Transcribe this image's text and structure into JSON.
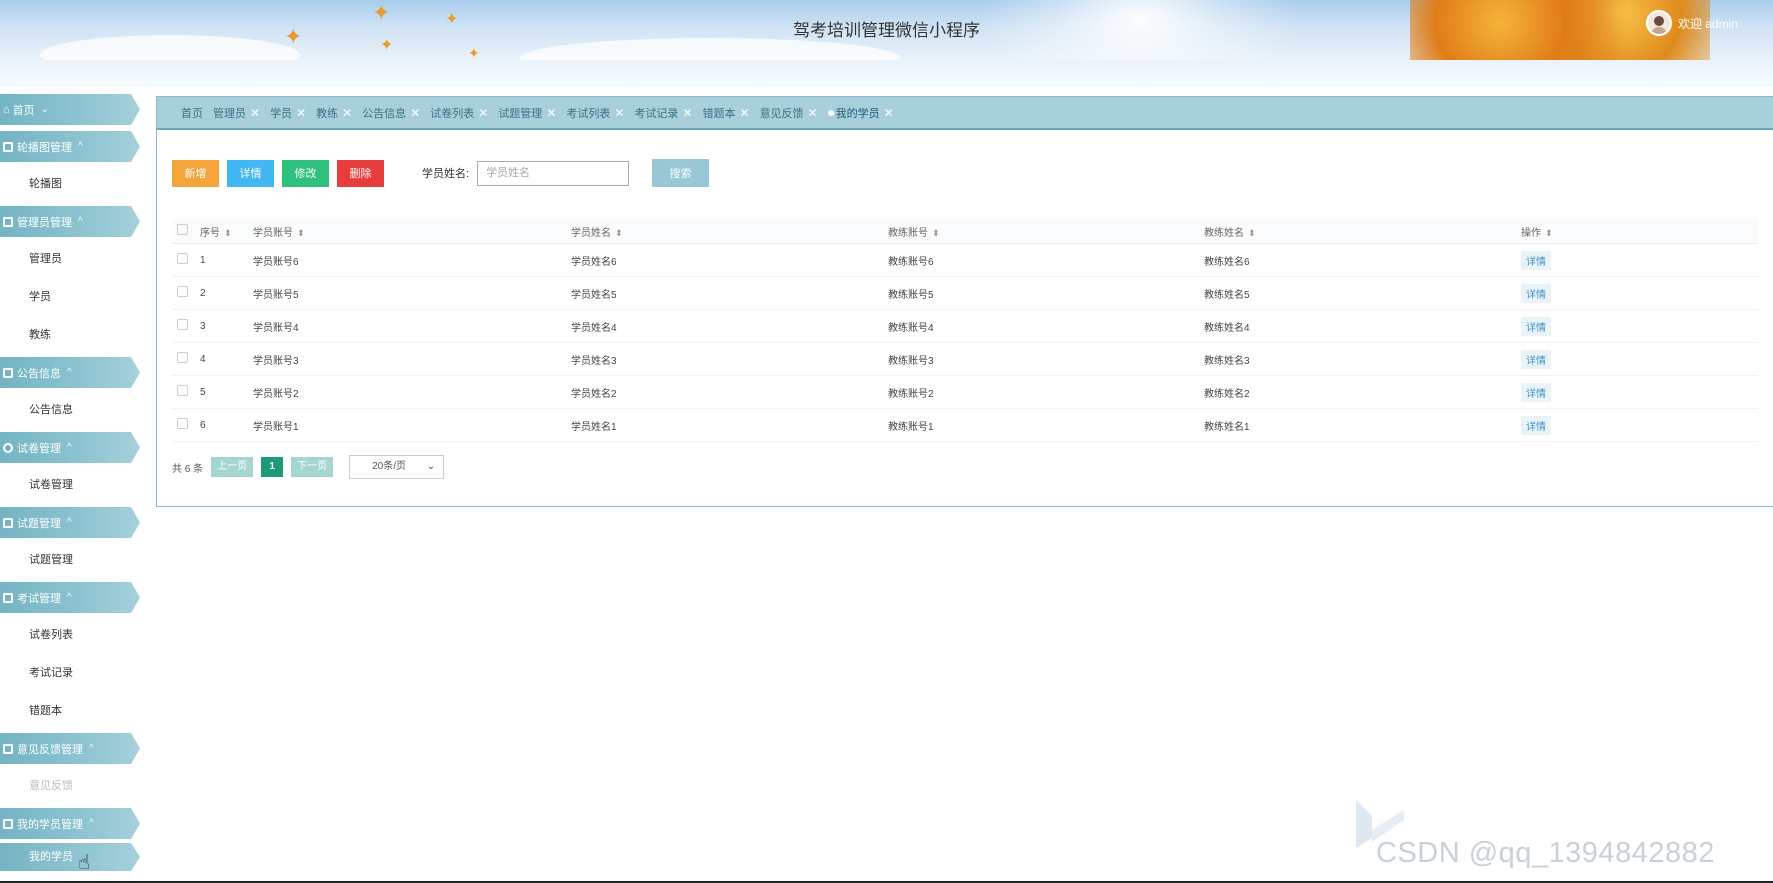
{
  "header": {
    "title": "驾考培训管理微信小程序",
    "welcome": "欢迎 admin"
  },
  "sidebar": {
    "groups": [
      {
        "label": "首页",
        "chevron": "⌄",
        "items": []
      },
      {
        "label": "轮播图管理",
        "chevron": "^",
        "items": [
          {
            "label": "轮播图"
          }
        ]
      },
      {
        "label": "管理员管理",
        "chevron": "^",
        "items": [
          {
            "label": "管理员"
          },
          {
            "label": "学员"
          },
          {
            "label": "教练"
          }
        ]
      },
      {
        "label": "公告信息",
        "chevron": "^",
        "items": [
          {
            "label": "公告信息"
          }
        ]
      },
      {
        "label": "试卷管理",
        "chevron": "^",
        "items": [
          {
            "label": "试卷管理"
          }
        ]
      },
      {
        "label": "试题管理",
        "chevron": "^",
        "items": [
          {
            "label": "试题管理"
          }
        ]
      },
      {
        "label": "考试管理",
        "chevron": "^",
        "items": [
          {
            "label": "试卷列表"
          },
          {
            "label": "考试记录"
          },
          {
            "label": "错题本"
          }
        ]
      },
      {
        "label": "意见反馈管理",
        "chevron": "^",
        "items": [
          {
            "label": "意见反馈"
          }
        ]
      },
      {
        "label": "我的学员管理",
        "chevron": "^",
        "items": [
          {
            "label": "我的学员"
          }
        ]
      }
    ]
  },
  "tabs": [
    "首页",
    "管理员",
    "学员",
    "教练",
    "公告信息",
    "试卷列表",
    "试题管理",
    "考试列表",
    "考试记录",
    "错题本",
    "意见反馈",
    "我的学员"
  ],
  "toolbar": {
    "add": "新增",
    "detail": "详情",
    "edit": "修改",
    "delete": "删除",
    "search_label": "学员姓名:",
    "search_placeholder": "学员姓名",
    "search_button": "搜索"
  },
  "table": {
    "headers": [
      "序号",
      "学员账号",
      "学员姓名",
      "教练账号",
      "教练姓名",
      "操作"
    ],
    "rows": [
      [
        "1",
        "学员账号6",
        "学员姓名6",
        "教练账号6",
        "教练姓名6",
        "详情"
      ],
      [
        "2",
        "学员账号5",
        "学员姓名5",
        "教练账号5",
        "教练姓名5",
        "详情"
      ],
      [
        "3",
        "学员账号4",
        "学员姓名4",
        "教练账号4",
        "教练姓名4",
        "详情"
      ],
      [
        "4",
        "学员账号3",
        "学员姓名3",
        "教练账号3",
        "教练姓名3",
        "详情"
      ],
      [
        "5",
        "学员账号2",
        "学员姓名2",
        "教练账号2",
        "教练姓名2",
        "详情"
      ],
      [
        "6",
        "学员账号1",
        "学员姓名1",
        "教练账号1",
        "教练姓名1",
        "详情"
      ]
    ]
  },
  "pager": {
    "total": "共 6 条",
    "prev": "上一页",
    "page": "1",
    "next": "下一页",
    "size": "20条/页"
  },
  "watermark": "CSDN @qq_1394842882",
  "colors": {
    "accent": "#8cc3d0",
    "add": "#f4a43a",
    "detail": "#43b7f2",
    "edit": "#2fc07e",
    "delete": "#e83c3c"
  }
}
